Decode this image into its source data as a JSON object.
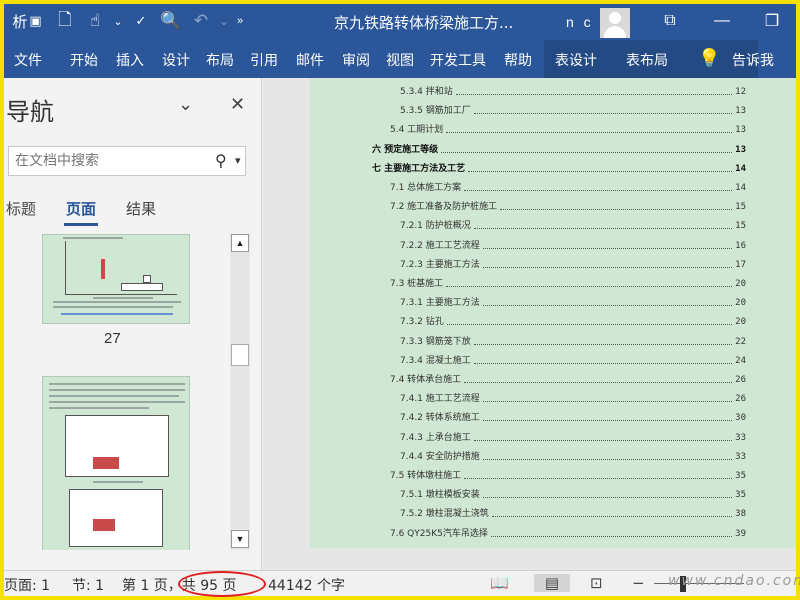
{
  "titlebar": {
    "app_icon_label": "析",
    "document_title": "京九铁路转体桥梁施工方...",
    "user_initials": "n c"
  },
  "ribbon": {
    "tabs": [
      "文件",
      "开始",
      "插入",
      "设计",
      "布局",
      "引用",
      "邮件",
      "审阅",
      "视图",
      "开发工具",
      "帮助",
      "表设计",
      "表布局"
    ],
    "tell_me": "告诉我"
  },
  "nav": {
    "title": "导航",
    "search_placeholder": "在文档中搜索",
    "tabs": [
      "标题",
      "页面",
      "结果"
    ],
    "active_tab": "页面",
    "page_number": "27"
  },
  "toc": [
    {
      "text": "5.3.4  拌和站",
      "page": "12",
      "level": 3
    },
    {
      "text": "5.3.5  钢筋加工厂",
      "page": "13",
      "level": 3
    },
    {
      "text": "5.4  工期计划",
      "page": "13",
      "level": 2
    },
    {
      "text": "六   预定施工等级",
      "page": "13",
      "level": 1
    },
    {
      "text": "七   主要施工方法及工艺",
      "page": "14",
      "level": 1
    },
    {
      "text": "7.1  总体施工方案",
      "page": "14",
      "level": 2
    },
    {
      "text": "7.2  施工准备及防护桩施工",
      "page": "15",
      "level": 2
    },
    {
      "text": "7.2.1  防护桩概况",
      "page": "15",
      "level": 3
    },
    {
      "text": "7.2.2  施工工艺流程",
      "page": "16",
      "level": 3
    },
    {
      "text": "7.2.3  主要施工方法",
      "page": "17",
      "level": 3
    },
    {
      "text": "7.3  桩基施工",
      "page": "20",
      "level": 2
    },
    {
      "text": "7.3.1  主要施工方法",
      "page": "20",
      "level": 3
    },
    {
      "text": "7.3.2  钻孔",
      "page": "20",
      "level": 3
    },
    {
      "text": "7.3.3  钢筋笼下放",
      "page": "22",
      "level": 3
    },
    {
      "text": "7.3.4  混凝土施工",
      "page": "24",
      "level": 3
    },
    {
      "text": "7.4  转体承台施工",
      "page": "26",
      "level": 2
    },
    {
      "text": "7.4.1  施工工艺流程",
      "page": "26",
      "level": 3
    },
    {
      "text": "7.4.2  转体系统施工",
      "page": "30",
      "level": 3
    },
    {
      "text": "7.4.3  上承台施工",
      "page": "33",
      "level": 3
    },
    {
      "text": "7.4.4  安全防护措施",
      "page": "33",
      "level": 3
    },
    {
      "text": "7.5  转体墩柱施工",
      "page": "35",
      "level": 2
    },
    {
      "text": "7.5.1  墩柱模板安装",
      "page": "35",
      "level": 3
    },
    {
      "text": "7.5.2  墩柱混凝土浇筑",
      "page": "38",
      "level": 3
    },
    {
      "text": "7.6  QY25K5汽车吊选择",
      "page": "39",
      "level": 2
    }
  ],
  "status": {
    "page": "页面: 1",
    "section": "节: 1",
    "page_of": "第 1 页，共 95 页",
    "word_count": "44142 个字",
    "watermark": "www.cndao.com"
  },
  "colors": {
    "ribbon": "#2b579a",
    "page_bg": "#cfe7d3",
    "frame": "#f5e000",
    "highlight": "#e02020"
  }
}
